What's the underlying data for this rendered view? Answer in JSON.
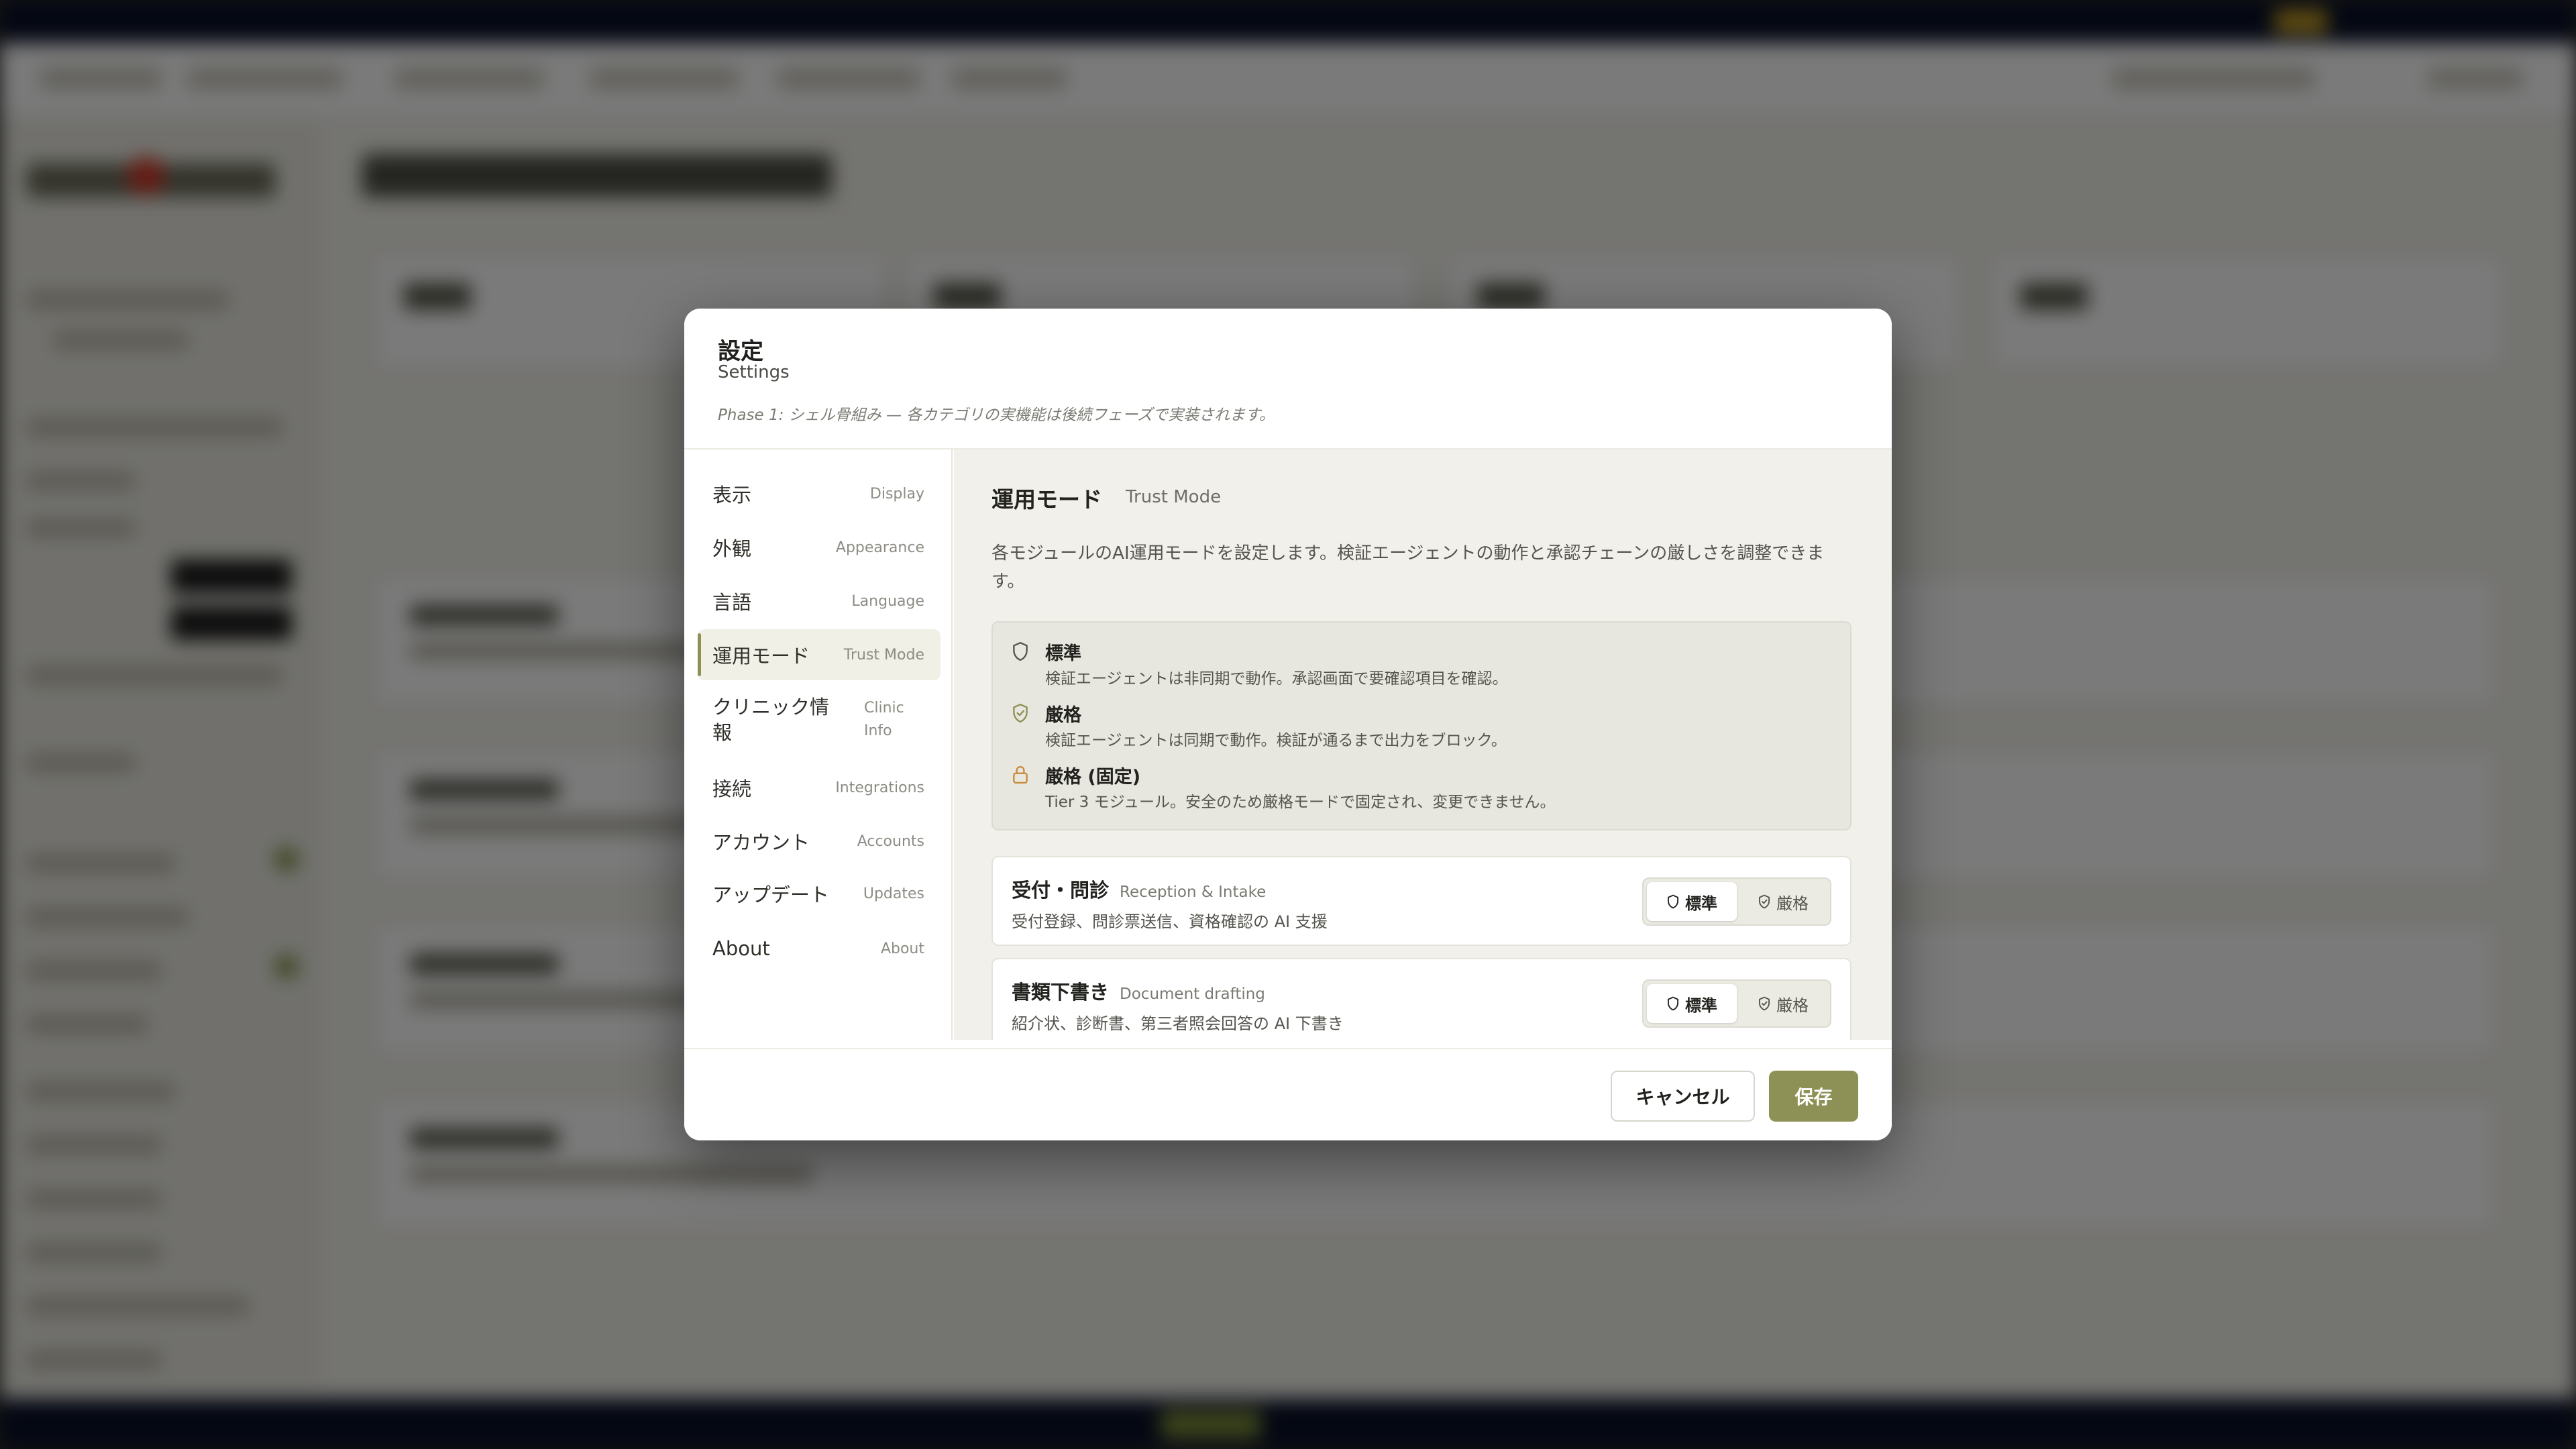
{
  "modal": {
    "title": "設定",
    "subtitle": "Settings",
    "note": "Phase 1: シェル骨組み — 各カテゴリの実機能は後続フェーズで実装されます。"
  },
  "nav": {
    "items": [
      {
        "jp": "表示",
        "en": "Display"
      },
      {
        "jp": "外観",
        "en": "Appearance"
      },
      {
        "jp": "言語",
        "en": "Language"
      },
      {
        "jp": "運用モード",
        "en": "Trust Mode",
        "active": true
      },
      {
        "jp": "クリニック情報",
        "en": "Clinic Info"
      },
      {
        "jp": "接続",
        "en": "Integrations"
      },
      {
        "jp": "アカウント",
        "en": "Accounts"
      },
      {
        "jp": "アップデート",
        "en": "Updates"
      },
      {
        "jp": "About",
        "en": "About"
      }
    ]
  },
  "section": {
    "title": "運用モード",
    "subtitle": "Trust Mode",
    "description": "各モジュールのAI運用モードを設定します。検証エージェントの動作と承認チェーンの厳しさを調整できます。"
  },
  "legend": [
    {
      "icon": "shield-outline-icon",
      "name": "標準",
      "desc": "検証エージェントは非同期で動作。承認画面で要確認項目を確認。"
    },
    {
      "icon": "shield-check-icon",
      "name": "厳格",
      "desc": "検証エージェントは同期で動作。検証が通るまで出力をブロック。"
    },
    {
      "icon": "lock-icon",
      "name": "厳格 (固定)",
      "desc": "Tier 3 モジュール。安全のため厳格モードで固定され、変更できません。"
    }
  ],
  "modules": [
    {
      "name": "受付・問診",
      "en": "Reception & Intake",
      "desc": "受付登録、問診票送信、資格確認の AI 支援",
      "selected": "標準"
    },
    {
      "name": "書類下書き",
      "en": "Document drafting",
      "desc": "紹介状、診断書、第三者照会回答の AI 下書き",
      "selected": "標準"
    }
  ],
  "mode_options": {
    "standard": "標準",
    "strict": "厳格"
  },
  "footer": {
    "cancel": "キャンセル",
    "save": "保存"
  },
  "colors": {
    "accent": "#8e9155",
    "lock": "#c98a3a",
    "shield_check": "#8e9155"
  }
}
